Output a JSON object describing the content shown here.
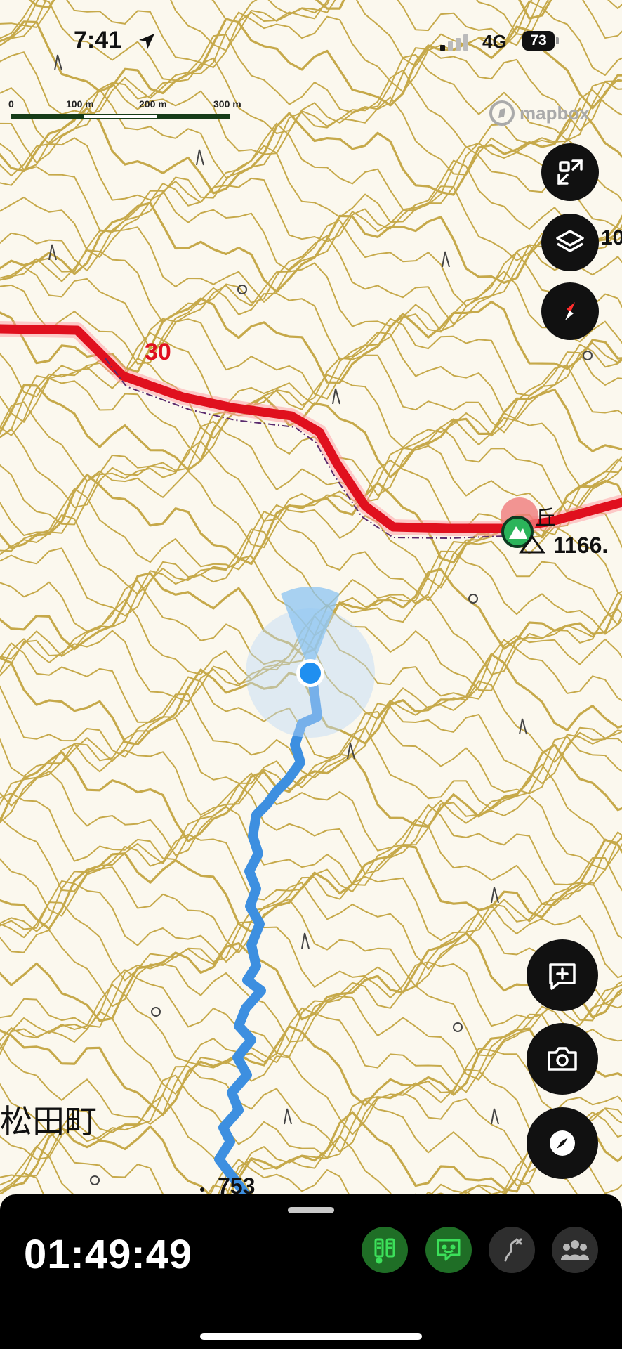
{
  "status_bar": {
    "time": "7:41",
    "network": "4G",
    "battery": "73"
  },
  "scale_bar": {
    "labels": [
      "0",
      "100 m",
      "200 m",
      "300 m"
    ]
  },
  "attribution": {
    "text": "mapbox"
  },
  "map": {
    "route_number": "30",
    "place_name": "松田町",
    "peak_elevation": "1166.",
    "spot_elevation": "753",
    "right_clipped_text": "10",
    "peak_kanji_fragment": "丘",
    "colors": {
      "contour": "#c6a94a",
      "road": "#e0101e",
      "track": "#3d8fe0",
      "location_dot": "#1f8ff0",
      "background": "#fbf8ee"
    }
  },
  "controls": {
    "top_right": [
      "fullscreen-icon",
      "layers-icon",
      "compass-icon"
    ],
    "bottom_right": [
      "add-note-icon",
      "camera-icon",
      "navigation-compass-icon"
    ]
  },
  "bottom_panel": {
    "elapsed_time": "01:49:49",
    "tools": [
      "hiking-poles-icon",
      "chat-bubble-icon",
      "route-off-icon",
      "group-icon"
    ]
  }
}
